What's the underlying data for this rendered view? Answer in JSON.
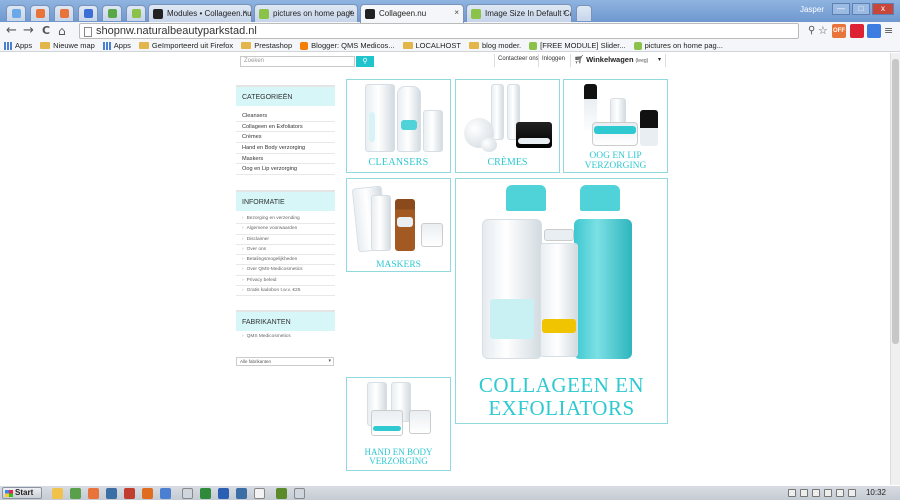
{
  "browser": {
    "user": "Jasper",
    "window_controls": {
      "minimize": "—",
      "maximize": "□",
      "close": "x"
    },
    "tabs": [
      {
        "label": "Modules • Collageen.nu",
        "active": false
      },
      {
        "label": "pictures on home page not s",
        "active": false
      },
      {
        "label": "Collageen.nu",
        "active": true
      },
      {
        "label": "Image Size In Default Categ",
        "active": false
      }
    ],
    "tab_close": "×",
    "nav": {
      "back": "←",
      "forward": "→",
      "reload": "C",
      "home": "⌂"
    },
    "url": "shopnw.naturalbeautyparkstad.nl",
    "star": "☆",
    "menu": "≡",
    "ext_off": "OFF",
    "bookmarks": [
      "Apps",
      "Nieuwe map",
      "Apps",
      "Geïmporteerd uit Firefox",
      "Prestashop",
      "Blogger: QMS Medicos...",
      "LOCALHOST",
      "blog moder.",
      "[FREE MODULE] Slider...",
      "pictures on home pag..."
    ]
  },
  "site": {
    "search_placeholder": "Zoeken",
    "search_icon": "⚲",
    "contact": "Contacteer ons",
    "login": "Inloggen",
    "cart_label": "Winkelwagen",
    "cart_status": "(leeg)",
    "cart_caret": "▾",
    "categories": {
      "title": "CATEGORIEËN",
      "items": [
        "Cleansers",
        "Collageen en Exfoliators",
        "Crèmes",
        "Hand en Body verzorging",
        "Maskers",
        "Oog en Lip verzorging"
      ]
    },
    "info": {
      "title": "INFORMATIE",
      "items": [
        "Bezorging en verzending",
        "Algemene voorwaarden",
        "Disclaimer",
        "Over ons",
        "Betalingsmogelijkheden",
        "Over QMS-Medicosmetics",
        "Privacy beleid",
        "Gratis kadobon t.w.v. €25"
      ]
    },
    "manufacturers": {
      "title": "FABRIKANTEN",
      "item": "QMS Medicosmetics",
      "select": "Alle fabrikanten",
      "select_caret": "▾"
    },
    "tiles": {
      "cleansers": "Cleansers",
      "cremes": "Crèmes",
      "oog_l1": "Oog en Lip",
      "oog_l2": "Verzorging",
      "maskers": "Maskers",
      "collageen_l1": "Collageen en",
      "collageen_l2": "Exfoliators",
      "hand_l1": "Hand en Body",
      "hand_l2": "Verzorging"
    }
  },
  "taskbar": {
    "start": "Start",
    "time": "10:32"
  },
  "colors": {
    "accent": "#20c4cc",
    "sidebar_head": "#d6f6f8",
    "tile_border": "#8fd9df"
  }
}
